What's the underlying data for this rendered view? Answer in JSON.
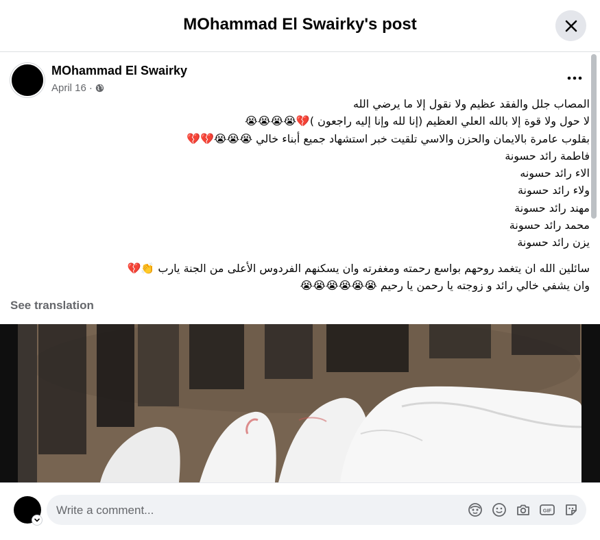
{
  "header": {
    "title": "MOhammad El Swairky's post"
  },
  "post": {
    "author": "MOhammad El Swairky",
    "date": "April 16",
    "separator": "·",
    "lines": [
      "المصاب جلل والفقد عظيم ولا نقول إلا ما يرضي الله",
      "لا حول ولا قوة إلا بالله العلي العظيم (إنا لله وإنا إليه راجعون )💔😭😭😭😭",
      " بقلوب عامرة بالايمان والحزن والاسي تلقيت خبر استشهاد جميع أبناء خالي 😭😭😭💔💔",
      "فاطمة رائد حسونة",
      "الاء رائد حسونه",
      "ولاء رائد حسونة",
      "مهند رائد حسونة",
      "محمد رائد حسونة",
      "يزن رائد حسونة"
    ],
    "prayer_lines": [
      " سائلين الله ان يتغمد روحهم بواسع رحمته ومغفرته وان يسكنهم الفردوس الأعلى من الجنة يارب 👏💔",
      "وان يشفي خالي رائد و زوجته يا رحمن يا رحيم 😭😭😭😭😭😭"
    ],
    "see_translation": "See translation"
  },
  "comment": {
    "placeholder": "Write a comment..."
  },
  "icons": {
    "close": "close-icon",
    "more": "more-options-icon",
    "privacy": "globe-icon",
    "avatar_chevron": "chevron-down-icon",
    "comment_tools": [
      "avatar-sticker-icon",
      "emoji-icon",
      "camera-icon",
      "gif-icon",
      "sticker-icon"
    ]
  },
  "colors": {
    "secondary_text": "#65676b",
    "background": "#ffffff",
    "comment_bg": "#f0f2f5"
  }
}
